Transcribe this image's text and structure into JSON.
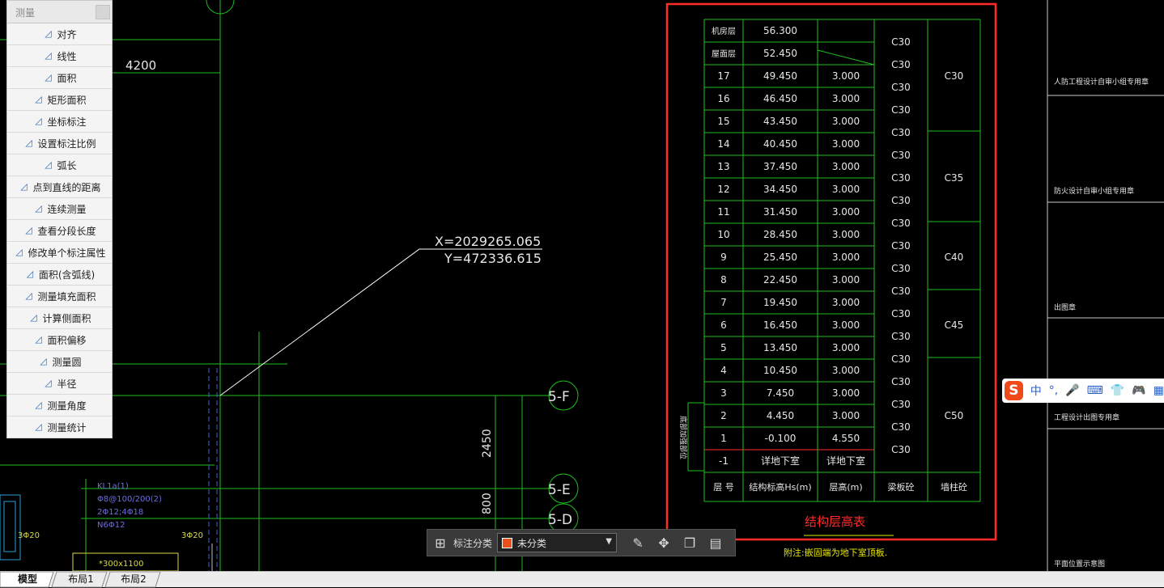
{
  "panel": {
    "title": "测量",
    "items": [
      {
        "label": "对齐",
        "icon": "align-icon"
      },
      {
        "label": "线性",
        "icon": "linear-icon"
      },
      {
        "label": "面积",
        "icon": "area-icon"
      },
      {
        "label": "矩形面积",
        "icon": "rect-area-icon"
      },
      {
        "label": "坐标标注",
        "icon": "coordinate-icon"
      },
      {
        "label": "设置标注比例",
        "icon": "scale-icon"
      },
      {
        "label": "弧长",
        "icon": "arc-length-icon"
      },
      {
        "label": "点到直线的距离",
        "icon": "point-line-icon"
      },
      {
        "label": "连续测量",
        "icon": "continuous-icon"
      },
      {
        "label": "查看分段长度",
        "icon": "segment-icon"
      },
      {
        "label": "修改单个标注属性",
        "icon": "edit-dim-icon"
      },
      {
        "label": "面积(含弧线)",
        "icon": "arc-area-icon"
      },
      {
        "label": "测量填充面积",
        "icon": "hatch-area-icon"
      },
      {
        "label": "计算侧面积",
        "icon": "side-area-icon"
      },
      {
        "label": "面积偏移",
        "icon": "area-offset-icon"
      },
      {
        "label": "测量圆",
        "icon": "circle-icon"
      },
      {
        "label": "半径",
        "icon": "radius-icon"
      },
      {
        "label": "测量角度",
        "icon": "angle-icon"
      },
      {
        "label": "测量统计",
        "icon": "stats-icon"
      }
    ]
  },
  "drawing": {
    "dim_4200": "4200",
    "dim_2450": "2450",
    "dim_800": "800",
    "coord_x": "X=2029265.065",
    "coord_y": "Y=472336.615",
    "axis_5f": "5-F",
    "axis_5e": "5-E",
    "axis_5d": "5-D",
    "beam_lines": [
      "KL1a(1)",
      "Φ8@100/200(2)",
      "2Φ12;4Φ18",
      "N6Φ12"
    ],
    "beam_left_tag": "3Φ20",
    "beam_right_tag": "3Φ20",
    "beam_box": "*300x1100",
    "table_title": "结构层高表",
    "table_note": "附注:嵌固端为地下室顶板.",
    "side_label": "底部加强部位",
    "right_labels": [
      "人防工程设计自审小组专用章",
      "防火设计自审小组专用章",
      "出图章",
      "工程设计出图专用章",
      "平面位置示意图"
    ],
    "table_header": [
      "层 号",
      "结构标高Hs(m)",
      "层高(m)",
      "梁板砼",
      "墙柱砼"
    ],
    "rows": [
      [
        "机房层",
        "56.300",
        ""
      ],
      [
        "屋面层",
        "52.450",
        ""
      ],
      [
        "17",
        "49.450",
        "3.000"
      ],
      [
        "16",
        "46.450",
        "3.000"
      ],
      [
        "15",
        "43.450",
        "3.000"
      ],
      [
        "14",
        "40.450",
        "3.000"
      ],
      [
        "13",
        "37.450",
        "3.000"
      ],
      [
        "12",
        "34.450",
        "3.000"
      ],
      [
        "11",
        "31.450",
        "3.000"
      ],
      [
        "10",
        "28.450",
        "3.000"
      ],
      [
        "9",
        "25.450",
        "3.000"
      ],
      [
        "8",
        "22.450",
        "3.000"
      ],
      [
        "7",
        "19.450",
        "3.000"
      ],
      [
        "6",
        "16.450",
        "3.000"
      ],
      [
        "5",
        "13.450",
        "3.000"
      ],
      [
        "4",
        "10.450",
        "3.000"
      ],
      [
        "3",
        "7.450",
        "3.000"
      ],
      [
        "2",
        "4.450",
        "3.000"
      ],
      [
        "1",
        "-0.100",
        "4.550"
      ],
      [
        "-1",
        "详地下室",
        "详地下室"
      ]
    ],
    "slab_grade": "C30",
    "wall_grades": [
      {
        "label": "C30",
        "row_from": 0,
        "row_to": 5
      },
      {
        "label": "C35",
        "row_from": 5,
        "row_to": 9
      },
      {
        "label": "C40",
        "row_from": 9,
        "row_to": 12
      },
      {
        "label": "C45",
        "row_from": 12,
        "row_to": 15
      },
      {
        "label": "C50",
        "row_from": 15,
        "row_to": 20
      }
    ]
  },
  "toolbar": {
    "grid_icon": "grid-icon",
    "label": "标注分类",
    "selected": "未分类",
    "swatch_color": "#e8521a",
    "icons": [
      "edit-icon",
      "move-icon",
      "copy-icon",
      "paste-icon"
    ]
  },
  "ime": {
    "logo": "S",
    "lang": "中",
    "punct": "°,"
  },
  "tabs": [
    "模型",
    "布局1",
    "布局2"
  ],
  "colors": {
    "accent_red": "#ff2a2a",
    "grid_green": "#1fbf1f",
    "text_white": "#e6e6e6",
    "note_yellow": "#e8e800"
  }
}
